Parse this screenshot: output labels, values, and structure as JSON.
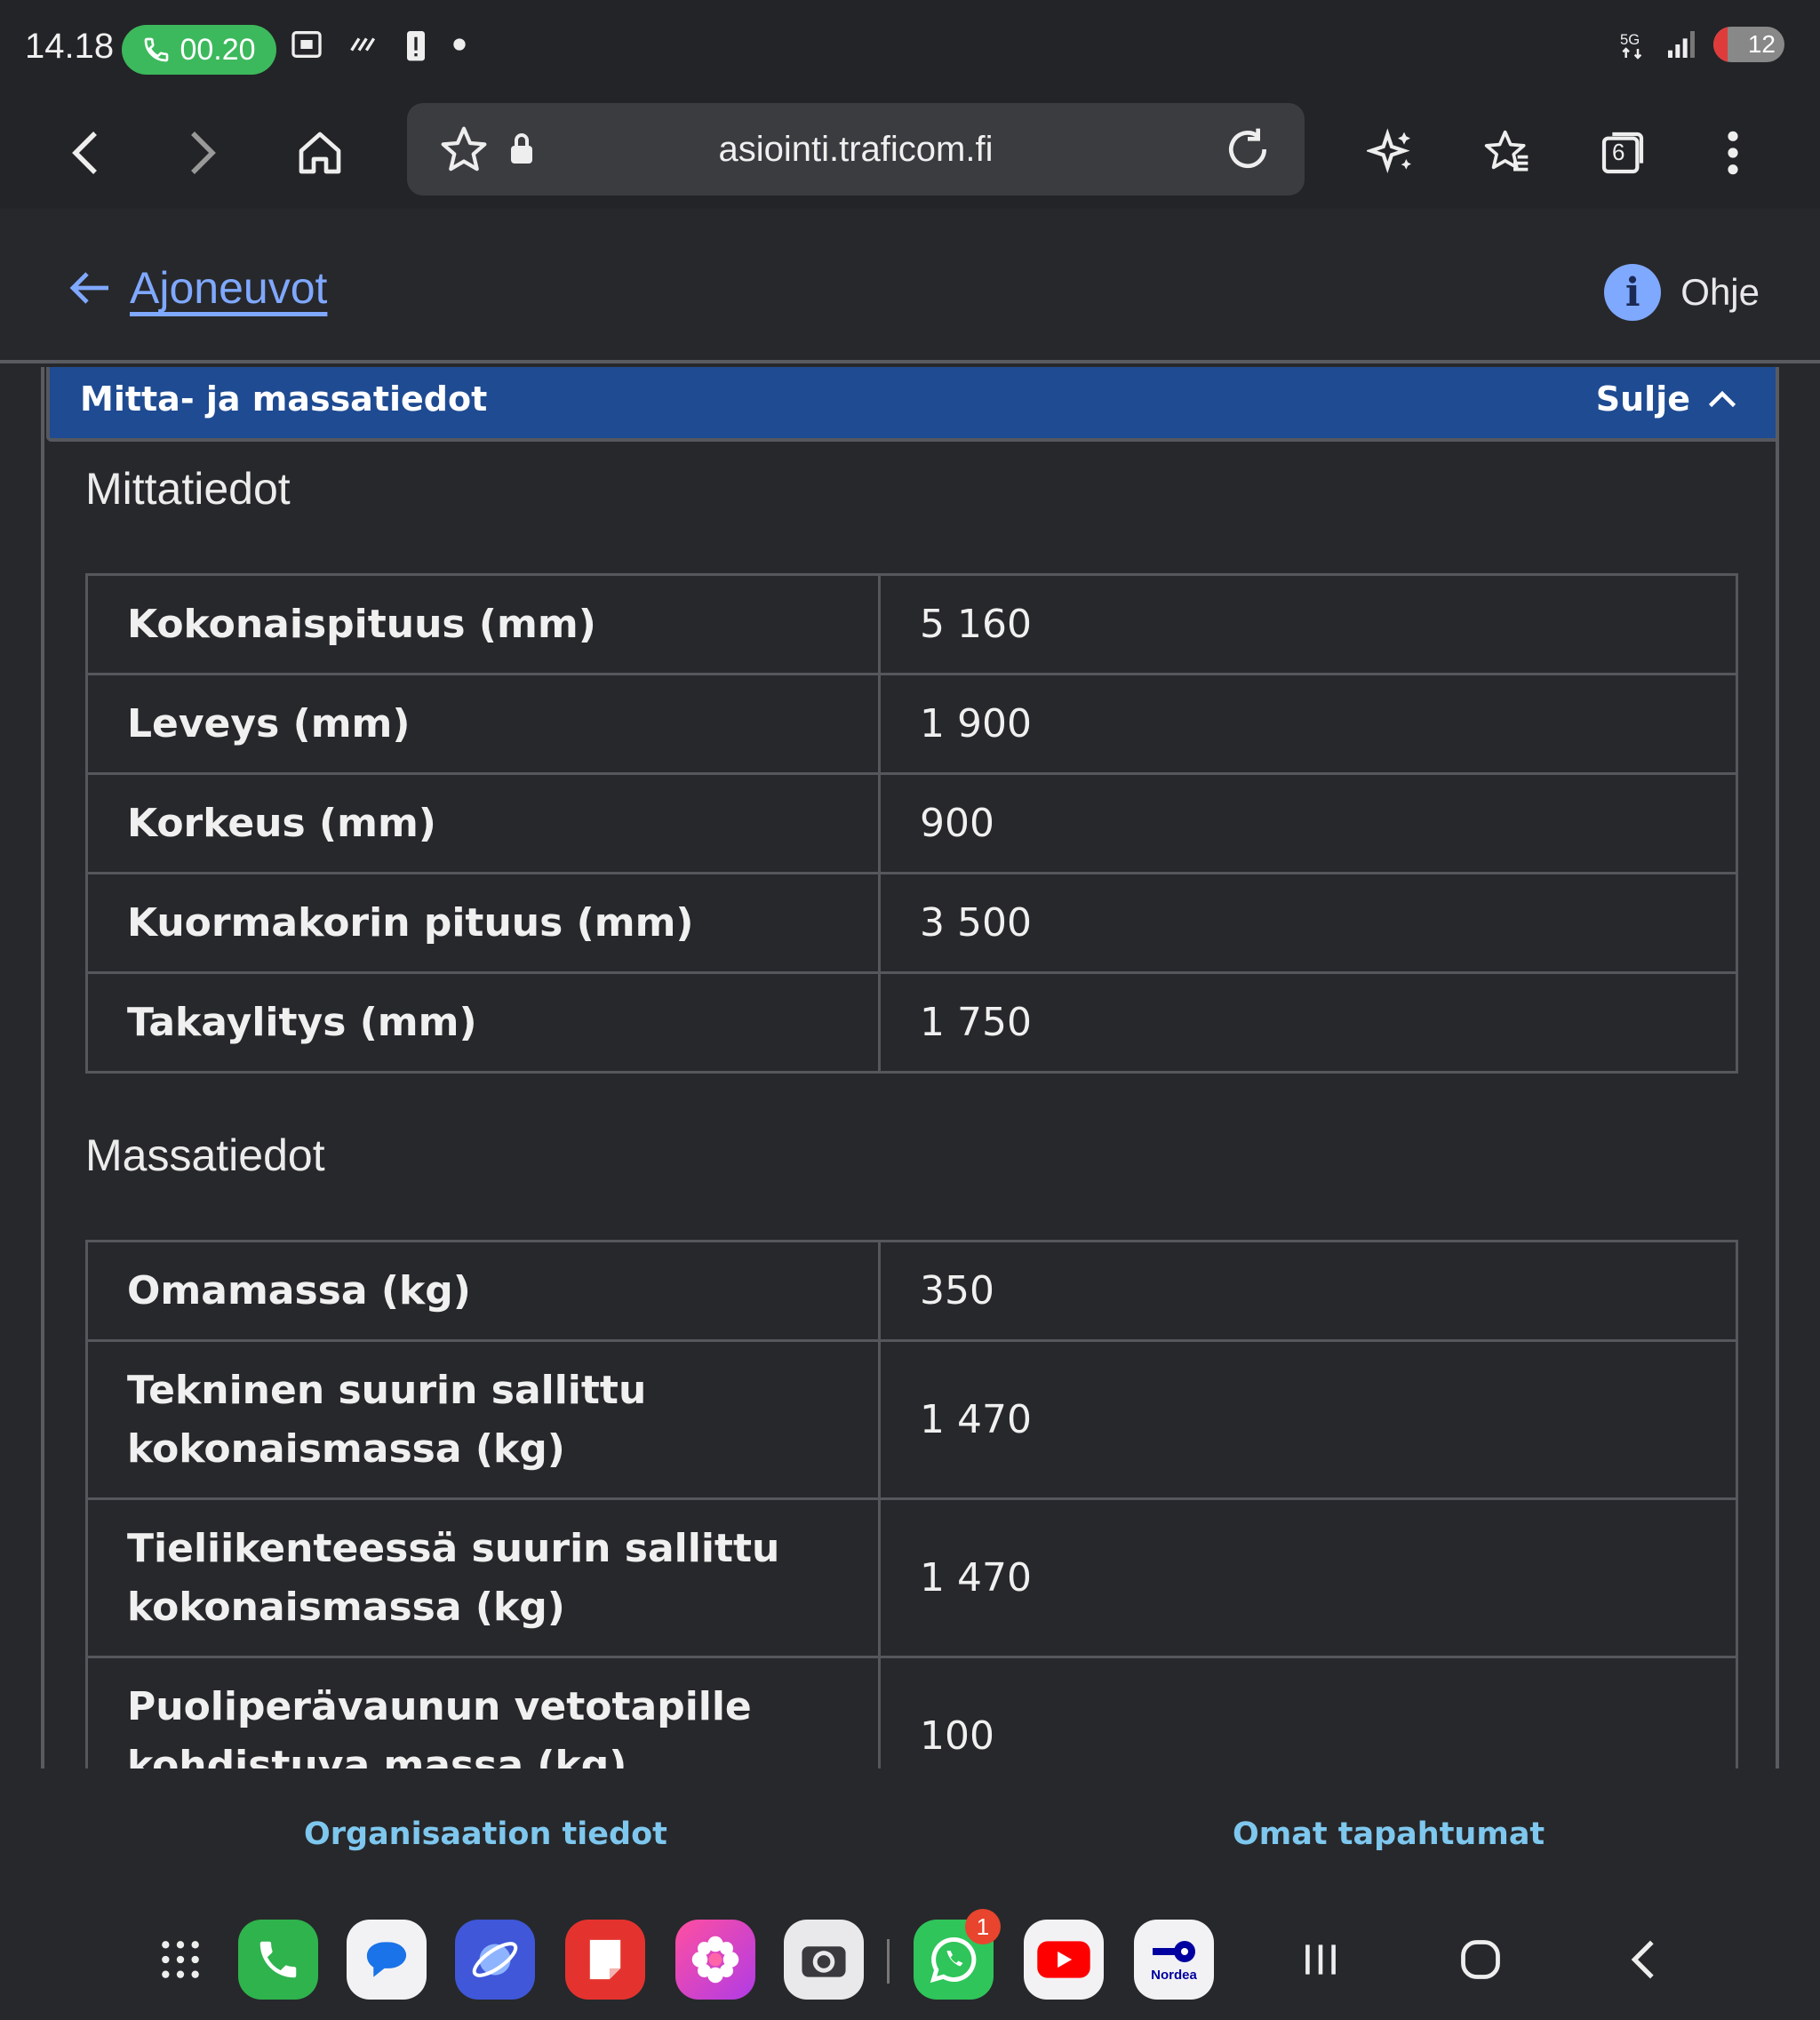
{
  "status_bar": {
    "time": "14.18",
    "call_duration": "00.20",
    "battery_level": "12",
    "network": "5G"
  },
  "browser": {
    "url": "asiointi.traficom.fi",
    "tab_count": "6"
  },
  "header": {
    "back_label": "Ajoneuvot",
    "help_label": "Ohje"
  },
  "section": {
    "title": "Mitta- ja massatiedot",
    "close_label": "Sulje"
  },
  "dimensions": {
    "heading": "Mittatiedot",
    "rows": [
      {
        "label": "Kokonaispituus (mm)",
        "value": "5 160"
      },
      {
        "label": "Leveys (mm)",
        "value": "1 900"
      },
      {
        "label": "Korkeus (mm)",
        "value": "900"
      },
      {
        "label": "Kuormakorin pituus (mm)",
        "value": "3 500"
      },
      {
        "label": "Takaylitys (mm)",
        "value": "1 750"
      }
    ]
  },
  "masses": {
    "heading": "Massatiedot",
    "rows": [
      {
        "label": "Omamassa (kg)",
        "value": "350"
      },
      {
        "label": "Tekninen suurin sallittu kokonaismassa (kg)",
        "value": "1 470"
      },
      {
        "label": "Tieliikenteessä suurin sallittu kokonaismassa (kg)",
        "value": "1 470"
      },
      {
        "label": "Puoliperävaunun vetotapille kohdistuva massa (kg)",
        "value": "100"
      }
    ]
  },
  "bottom_nav": {
    "left": "Organisaation tiedot",
    "right": "Omat tapahtumat"
  },
  "dock": {
    "whatsapp_badge": "1",
    "nordea_label": "Nordea"
  },
  "colors": {
    "section_bar": "#1e4b92",
    "link": "#7fa8ff",
    "bottom_link": "#7ec7ee",
    "call_pill": "#3cb95c"
  }
}
